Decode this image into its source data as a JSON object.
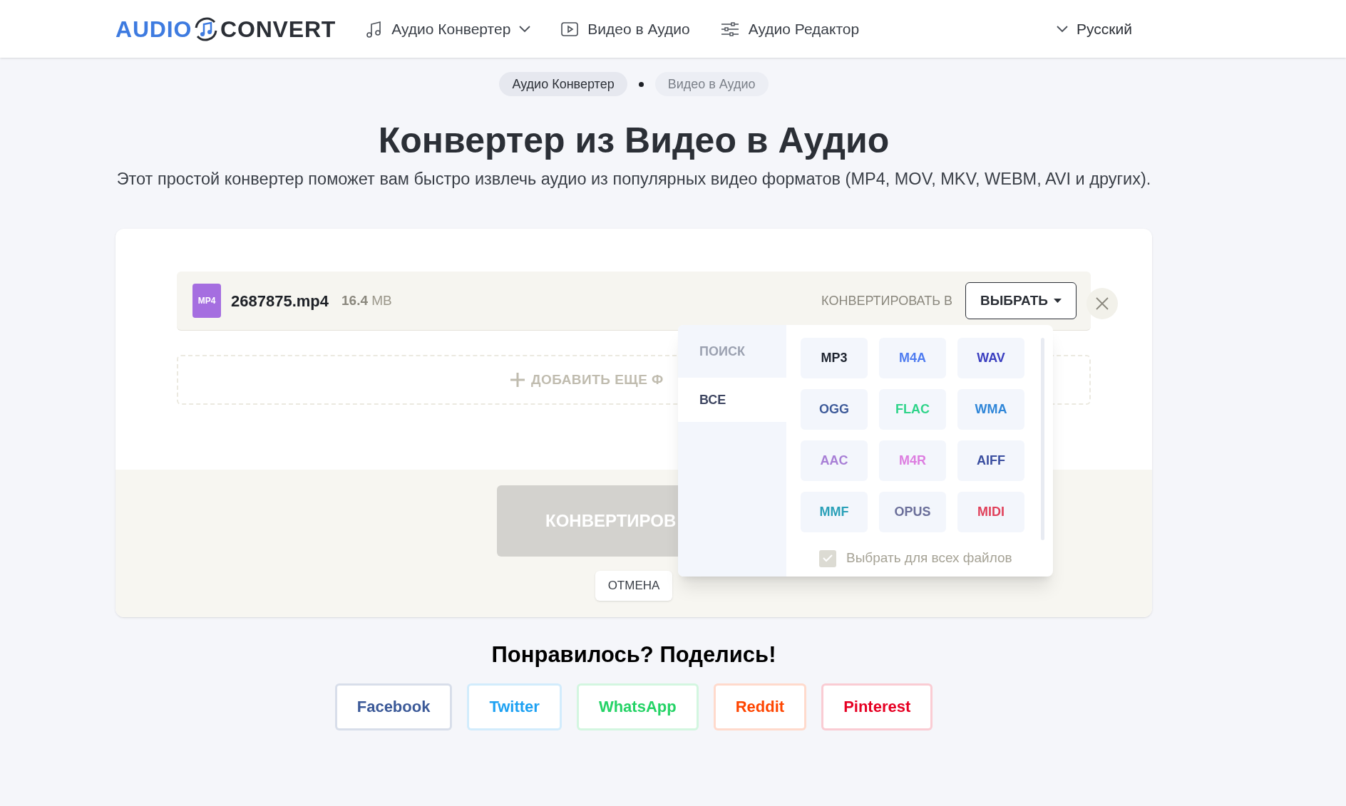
{
  "header": {
    "logo_left": "AUDIO",
    "logo_right": "CONVERT",
    "nav": [
      {
        "label": "Аудио Конвертер",
        "kind": "music",
        "dropdown": true
      },
      {
        "label": "Видео в Аудио",
        "kind": "video",
        "dropdown": false
      },
      {
        "label": "Аудио Редактор",
        "kind": "sliders",
        "dropdown": false
      }
    ],
    "language": "Русский"
  },
  "breadcrumbs": [
    {
      "label": "Аудио Конвертер",
      "selected": false
    },
    {
      "label": "Видео в Аудио",
      "selected": true
    }
  ],
  "title": "Конвертер из Видео в Аудио",
  "subtitle": "Этот простой конвертер поможет вам быстро извлечь аудио из популярных видео форматов (MP4, MOV, MKV, WEBM, AVI и других).",
  "file": {
    "badge": "MP4",
    "name": "2687875.mp4",
    "size_value": "16.4",
    "size_unit": "MB",
    "convert_label": "КОНВЕРТИРОВАТЬ В",
    "select_button": "ВЫБРАТЬ"
  },
  "add_more": "ДОБАВИТЬ ЕЩЕ Ф",
  "convert_button": "КОНВЕРТИРОВ",
  "cancel_button": "ОТМЕНА",
  "format_menu": {
    "search": {
      "placeholder": "ПОИСК"
    },
    "categories": [
      {
        "label": "ВСЕ",
        "selected": true
      }
    ],
    "formats": [
      {
        "label": "MP3",
        "color": "#1f2530"
      },
      {
        "label": "M4A",
        "color": "#4f7cf0"
      },
      {
        "label": "WAV",
        "color": "#3b3fc0"
      },
      {
        "label": "OGG",
        "color": "#3d5a99"
      },
      {
        "label": "FLAC",
        "color": "#2fd48a"
      },
      {
        "label": "WMA",
        "color": "#2f86d8"
      },
      {
        "label": "AAC",
        "color": "#a87fd6"
      },
      {
        "label": "M4R",
        "color": "#dd7de0"
      },
      {
        "label": "AIFF",
        "color": "#3b4fa0"
      },
      {
        "label": "MMF",
        "color": "#2aa0b8"
      },
      {
        "label": "OPUS",
        "color": "#6b6f9a"
      },
      {
        "label": "MIDI",
        "color": "#e0405a"
      }
    ],
    "apply_all": {
      "label": "Выбрать для всех файлов",
      "checked": true
    }
  },
  "share": {
    "title": "Понравилось? Поделись!",
    "buttons": [
      {
        "label": "Facebook",
        "color": "#3b5998"
      },
      {
        "label": "Twitter",
        "color": "#1da1f2"
      },
      {
        "label": "WhatsApp",
        "color": "#25d366"
      },
      {
        "label": "Reddit",
        "color": "#ff4500"
      },
      {
        "label": "Pinterest",
        "color": "#e60023"
      }
    ]
  }
}
